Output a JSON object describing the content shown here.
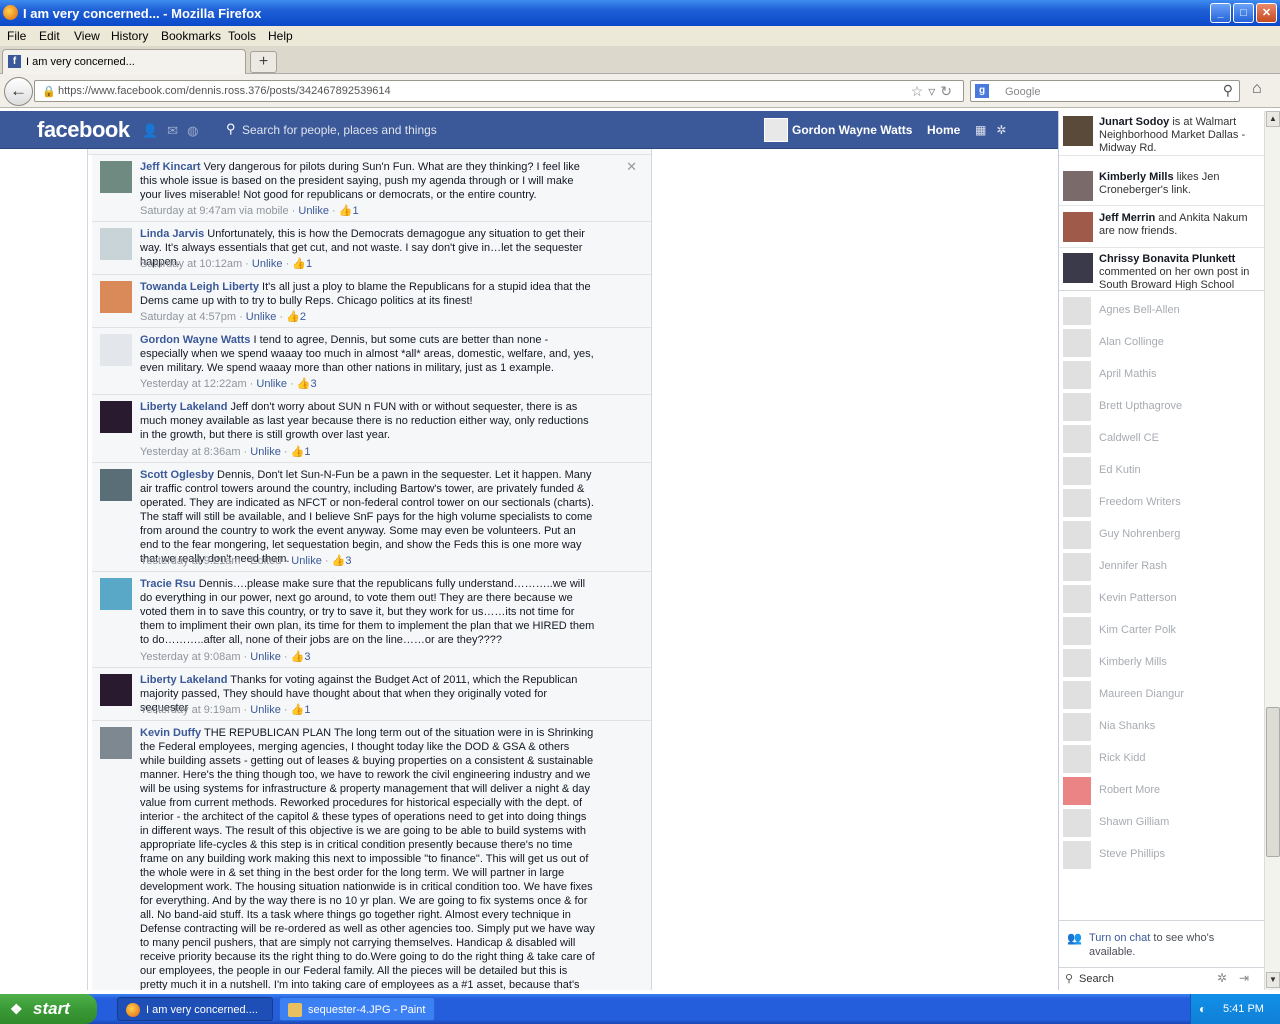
{
  "window": {
    "title": "I am very concerned... - Mozilla Firefox",
    "buttons": {
      "minimize": "_",
      "maximize": "□",
      "close": "✕"
    }
  },
  "menu": [
    "File",
    "Edit",
    "View",
    "History",
    "Bookmarks",
    "Tools",
    "Help"
  ],
  "browser": {
    "tab_title": "I am very concerned...",
    "new_tab": "+",
    "url": "https://www.facebook.com/dennis.ross.376/posts/342467892539614",
    "search_placeholder": "Google"
  },
  "fb": {
    "logo": "facebook",
    "search_placeholder": "Search for people, places and things",
    "user_name": "Gordon Wayne Watts",
    "home": "Home"
  },
  "comments": [
    {
      "author": "Jeff Kincart",
      "text": "Very dangerous for pilots during Sun'n Fun. What are they thinking? I feel like this whole issue is based on the president saying, push my agenda through or I will make your lives miserable! Not good for republicans or democrats, or the entire country.",
      "time": "Saturday at 9:47am via mobile",
      "edited": "",
      "action": "Unlike",
      "likes": "1",
      "remove": "✕"
    },
    {
      "author": "Linda Jarvis",
      "text": "Unfortunately, this is how the Democrats demagogue any situation to get their way. It's always essentials that get cut, and not waste. I say don't give in…let the sequester happen.",
      "time": "Saturday at 10:12am",
      "edited": "",
      "action": "Unlike",
      "likes": "1"
    },
    {
      "author": "Towanda Leigh Liberty",
      "text": "It's all just a ploy to blame the Republicans for a stupid idea that the Dems came up with to try to bully Reps. Chicago politics at its finest!",
      "time": "Saturday at 4:57pm",
      "edited": "",
      "action": "Unlike",
      "likes": "2"
    },
    {
      "author": "Gordon Wayne Watts",
      "text": "I tend to agree, Dennis, but some cuts are better than none -especially when we spend waaay too much in almost *all* areas, domestic, welfare, and, yes, even military. We spend waaay more than other nations in military, just as 1 example.",
      "time": "Yesterday at 12:22am",
      "edited": "",
      "action": "Unlike",
      "likes": "3"
    },
    {
      "author": "Liberty Lakeland",
      "text": "Jeff don't worry about SUN n FUN with or without sequester, there is as much money available as last year because there is no reduction either way, only reductions in the growth, but there is still growth over last year.",
      "time": "Yesterday at 8:36am",
      "edited": "",
      "action": "Unlike",
      "likes": "1"
    },
    {
      "author": "Scott Oglesby",
      "text": "Dennis, Don't let Sun-N-Fun be a pawn in the sequester. Let it happen. Many air traffic control towers around the country, including Bartow's tower, are privately funded & operated. They are indicated as NFCT or non-federal control tower on our sectionals (charts). The staff will still be available, and I believe SnF pays for the high volume specialists to come from around the country to work the event anyway. Some may even be volunteers. Put an end to the fear mongering, let sequestation begin, and show the Feds this is one more way that we really don't need them.",
      "time": "Yesterday at 9:21am",
      "edited": "Edited",
      "action": "Unlike",
      "likes": "3"
    },
    {
      "author": "Tracie Rsu",
      "text": "Dennis….please make sure that the republicans fully understand………..we will do everything in our power, next go around, to vote them out! They are there because we voted them in to save this country, or try to save it, but they work for us……its not time for them to impliment their own plan, its time for them to implement the plan that we HIRED them to do………..after all, none of their jobs are on the line……or are they????",
      "time": "Yesterday at 9:08am",
      "edited": "",
      "action": "Unlike",
      "likes": "3"
    },
    {
      "author": "Liberty Lakeland",
      "text": "Thanks for voting against the Budget Act of 2011, which the Republican majority passed, They should have thought about that when they originally voted for sequester",
      "time": "Yesterday at 9:19am",
      "edited": "",
      "action": "Unlike",
      "likes": "1"
    },
    {
      "author": "Kevin Duffy",
      "text": "THE REPUBLICAN PLAN The long term out of the situation were in is Shrinking the Federal employees, merging agencies, I thought today like the DOD & GSA & others while building assets - getting out of leases & buying properties on a consistent & sustainable manner. Here's the thing though too, we have to rework the civil engineering industry and we will be using systems for infrastructure & property management that will deliver a night & day value from current methods. Reworked procedures for historical especially with the dept. of interior - the architect of the capitol & these types of operations need to get into doing things in different ways. The result of this objective is we are going to be able to build systems with appropriate life-cycles & this step is in critical condition presently because there's no time frame on any building work making this next to impossible \"to finance\". This will get us out of the whole were in & set thing in the best order for the long term. We will partner in large development work. The housing situation nationwide is in critical condition too. We have fixes for everything. And by the way there is no 10 yr plan. We are going to fix systems once & for all. No band-aid stuff. Its a task where things go together right. Almost every technique in Defense contracting will be re-ordered as well as other agencies too. Simply put we have way to many pencil pushers, that are simply not carrying themselves. Handicap & disabled will receive priority because its the right thing to do.Were going to do the right thing & take care of our employees, the people in our Federal family. All the pieces will be detailed but this is pretty much it in a nutshell. I'm into taking care of employees as a #1 asset, because that's the right way to think. In this case the people Obama hired are simply not needed. There's going to be a little bad blood but at the end of the day, they shouldn't"
    }
  ],
  "ticker": [
    {
      "name": "Junart Sodoy",
      "text": " is at Walmart Neighborhood Market Dallas - Midway Rd."
    },
    {
      "name": "Kimberly Mills",
      "text": " likes Jen Croneberger's link."
    },
    {
      "name": "Jeff Merrin",
      "text": " and Ankita Nakum are now friends."
    },
    {
      "name": "Chrissy Bonavita Plunkett",
      "text": " commented on her own post in South Broward High School"
    }
  ],
  "friends": [
    "Agnes Bell-Allen",
    "Alan Collinge",
    "April Mathis",
    "Brett Upthagrove",
    "Caldwell CE",
    "Ed Kutin",
    "Freedom Writers",
    "Guy Nohrenberg",
    "Jennifer Rash",
    "Kevin Patterson",
    "Kim Carter Polk",
    "Kimberly Mills",
    "Maureen Diangur",
    "Nia Shanks",
    "Rick Kidd",
    "Robert More",
    "Shawn Gilliam",
    "Steve Phillips"
  ],
  "chat": {
    "turn_on_link": "Turn on chat",
    "turn_on_rest": " to see who's available.",
    "search": "Search"
  },
  "taskbar": {
    "start": "start",
    "tasks": [
      "I am very concerned....",
      "sequester-4.JPG - Paint"
    ],
    "clock": "5:41 PM"
  }
}
